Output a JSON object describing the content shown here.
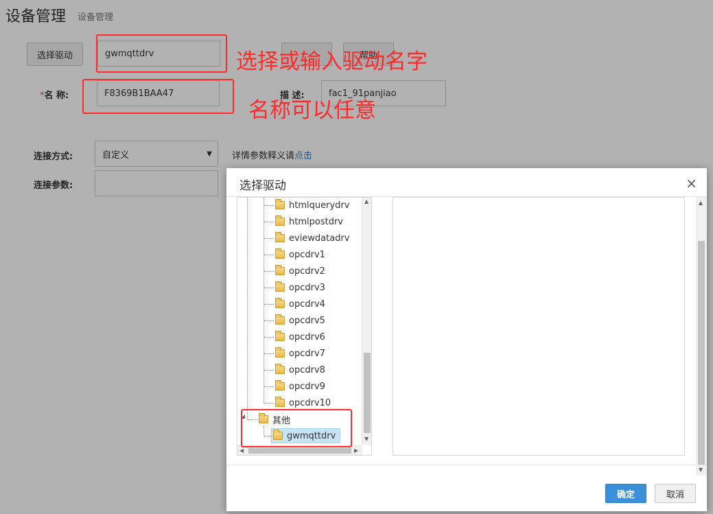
{
  "page": {
    "title": "设备管理",
    "subtitle": "设备管理"
  },
  "form": {
    "select_driver_label": "选择驱动",
    "driver_value": "gwmqttdrv",
    "hidden_btn1": "",
    "hidden_btn2": "帮助",
    "name_label": "名  称:",
    "name_required_mark": "*",
    "name_value": "F8369B1BAA47",
    "desc_label": "描  述:",
    "desc_value": "fac1_91panjiao",
    "conn_mode_label": "连接方式:",
    "conn_mode_value": "自定义",
    "detail_text": "详情参数释义请",
    "detail_link": "点击",
    "conn_params_label": "连接参数:",
    "conn_params_value": ""
  },
  "annotations": {
    "driver_note": "选择或输入驱动名字",
    "name_note": "名称可以任意"
  },
  "dialog": {
    "title": "选择驱动",
    "close_icon": "×",
    "tree": {
      "drivers": [
        "htmlquerydrv",
        "htmlpostdrv",
        "eviewdatadrv",
        "opcdrv1",
        "opcdrv2",
        "opcdrv3",
        "opcdrv4",
        "opcdrv5",
        "opcdrv6",
        "opcdrv7",
        "opcdrv8",
        "opcdrv9",
        "opcdrv10"
      ],
      "group_other": "其他",
      "selected_child": "gwmqttdrv"
    },
    "confirm_label": "确定",
    "cancel_label": "取消"
  },
  "colors": {
    "primary": "#3b8fd9",
    "annotation": "#ff2a2a",
    "link": "#337ab7"
  }
}
